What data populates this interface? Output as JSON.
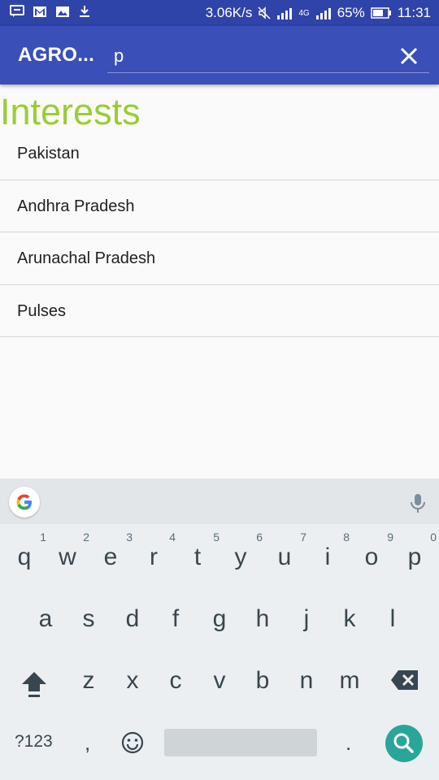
{
  "statusbar": {
    "speed": "3.06K/s",
    "network": "4G",
    "battery": "65%",
    "time": "11:31"
  },
  "appbar": {
    "title": "AGRO...",
    "search_value": "p"
  },
  "heading": "Interests",
  "results": [
    {
      "label": "Pakistan"
    },
    {
      "label": "Andhra Pradesh"
    },
    {
      "label": "Arunachal Pradesh"
    },
    {
      "label": "Pulses"
    }
  ],
  "keyboard": {
    "row1": [
      {
        "ch": "q",
        "hint": "1"
      },
      {
        "ch": "w",
        "hint": "2"
      },
      {
        "ch": "e",
        "hint": "3"
      },
      {
        "ch": "r",
        "hint": "4"
      },
      {
        "ch": "t",
        "hint": "5"
      },
      {
        "ch": "y",
        "hint": "6"
      },
      {
        "ch": "u",
        "hint": "7"
      },
      {
        "ch": "i",
        "hint": "8"
      },
      {
        "ch": "o",
        "hint": "9"
      },
      {
        "ch": "p",
        "hint": "0"
      }
    ],
    "row2": [
      "a",
      "s",
      "d",
      "f",
      "g",
      "h",
      "j",
      "k",
      "l"
    ],
    "row3": [
      "z",
      "x",
      "c",
      "v",
      "b",
      "n",
      "m"
    ],
    "mode_key": "?123",
    "comma": ",",
    "period": "."
  },
  "colors": {
    "appbar": "#3a4fb8",
    "statusbar": "#2f44a8",
    "heading": "#9acd32",
    "search_key": "#2aa599"
  },
  "icons": [
    "message-icon",
    "gmail-icon",
    "image-icon",
    "download-icon",
    "mute-icon",
    "signal-icon",
    "battery-icon",
    "close-icon",
    "google-icon",
    "mic-icon",
    "shift-icon",
    "backspace-icon",
    "emoji-icon",
    "search-icon"
  ]
}
